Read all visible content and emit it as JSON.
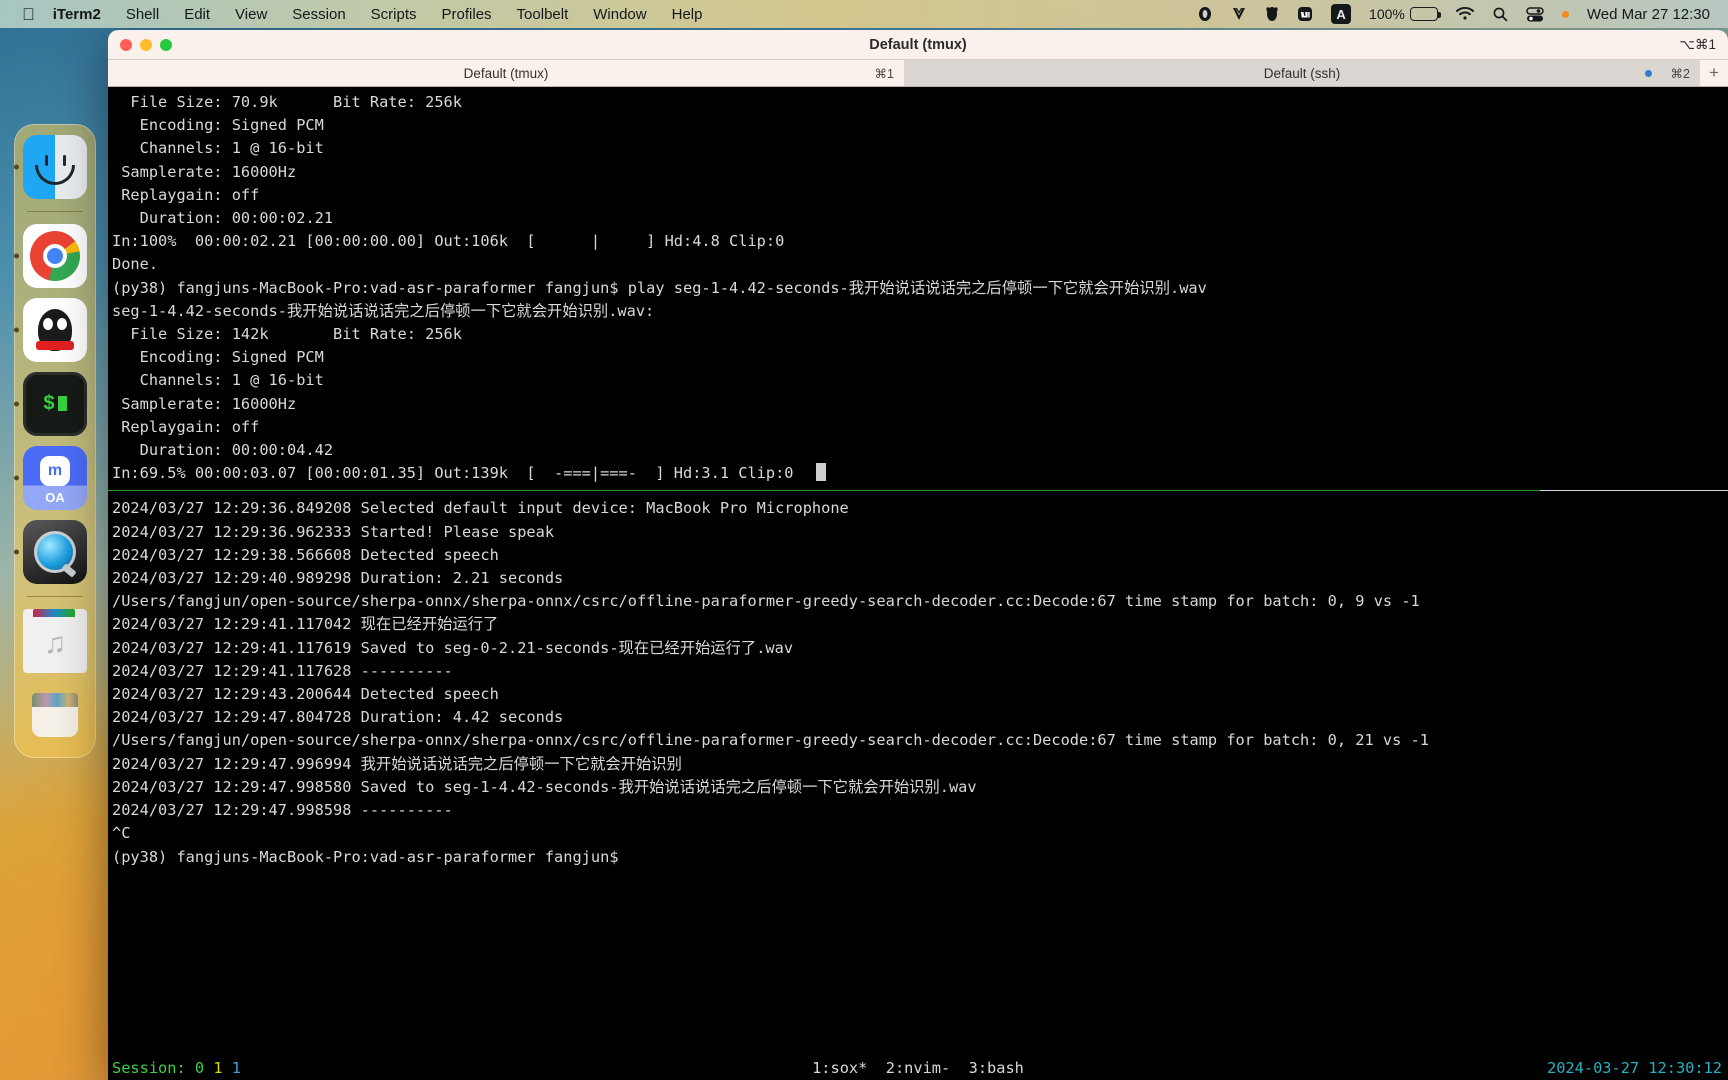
{
  "menubar": {
    "apple_icon": "apple-icon",
    "items": [
      {
        "label": "iTerm2",
        "bold": true
      },
      {
        "label": "Shell",
        "bold": false
      },
      {
        "label": "Edit",
        "bold": false
      },
      {
        "label": "View",
        "bold": false
      },
      {
        "label": "Session",
        "bold": false
      },
      {
        "label": "Scripts",
        "bold": false
      },
      {
        "label": "Profiles",
        "bold": false
      },
      {
        "label": "Toolbelt",
        "bold": false
      },
      {
        "label": "Window",
        "bold": false
      },
      {
        "label": "Help",
        "bold": false
      }
    ],
    "tray": {
      "battery_percent": "100%",
      "input_source": "A",
      "icons": [
        "opera-icon",
        "v-logo-icon",
        "qq-penguin-icon",
        "mi-icon",
        "input-source-icon",
        "battery-icon",
        "wifi-icon",
        "search-icon",
        "control-center-icon",
        "notification-dot-icon"
      ]
    },
    "clock": "Wed Mar 27  12:30"
  },
  "dock": {
    "items": [
      {
        "name": "finder",
        "label": "Finder",
        "running": true
      },
      {
        "name": "chrome",
        "label": "Google Chrome",
        "running": true
      },
      {
        "name": "qq",
        "label": "QQ",
        "running": true
      },
      {
        "name": "terminal",
        "label": "Terminal",
        "running": true
      },
      {
        "name": "mi-oa",
        "label": "OA",
        "running": true
      },
      {
        "name": "quicktime",
        "label": "QuickTime Player",
        "running": true
      },
      {
        "name": "music-folder",
        "label": "Music",
        "running": false
      },
      {
        "name": "trash",
        "label": "Trash",
        "running": false
      }
    ]
  },
  "window": {
    "title": "Default (tmux)",
    "badge": "⌥⌘1",
    "tabs": [
      {
        "label": "Default (tmux)",
        "shortcut": "⌘1",
        "active": false,
        "dot": false
      },
      {
        "label": "Default (ssh)",
        "shortcut": "⌘2",
        "active": true,
        "dot": true
      }
    ],
    "new_tab_label": "+"
  },
  "terminal": {
    "top_pane": [
      "  File Size: 70.9k      Bit Rate: 256k",
      "   Encoding: Signed PCM",
      "   Channels: 1 @ 16-bit",
      " Samplerate: 16000Hz",
      " Replaygain: off",
      "   Duration: 00:00:02.21",
      "",
      "In:100%  00:00:02.21 [00:00:00.00] Out:106k  [      |     ] Hd:4.8 Clip:0",
      "Done.",
      "(py38) fangjuns-MacBook-Pro:vad-asr-paraformer fangjun$ play seg-1-4.42-seconds-我开始说话说话完之后停顿一下它就会开始识别.wav",
      "",
      "seg-1-4.42-seconds-我开始说话说话完之后停顿一下它就会开始识别.wav:",
      "",
      "  File Size: 142k       Bit Rate: 256k",
      "   Encoding: Signed PCM",
      "   Channels: 1 @ 16-bit",
      " Samplerate: 16000Hz",
      " Replaygain: off",
      "   Duration: 00:00:04.42",
      "",
      "In:69.5% 00:00:03.07 [00:00:01.35] Out:139k  [  -===|===-  ] Hd:3.1 Clip:0"
    ],
    "bottom_pane": [
      "2024/03/27 12:29:36.849208 Selected default input device: MacBook Pro Microphone",
      "2024/03/27 12:29:36.962333 Started! Please speak",
      "2024/03/27 12:29:38.566608 Detected speech",
      "2024/03/27 12:29:40.989298 Duration: 2.21 seconds",
      "/Users/fangjun/open-source/sherpa-onnx/sherpa-onnx/csrc/offline-paraformer-greedy-search-decoder.cc:Decode:67 time stamp for batch: 0, 9 vs -1",
      "2024/03/27 12:29:41.117042 现在已经开始运行了",
      "2024/03/27 12:29:41.117619 Saved to seg-0-2.21-seconds-现在已经开始运行了.wav",
      "2024/03/27 12:29:41.117628 ----------",
      "2024/03/27 12:29:43.200644 Detected speech",
      "2024/03/27 12:29:47.804728 Duration: 4.42 seconds",
      "/Users/fangjun/open-source/sherpa-onnx/sherpa-onnx/csrc/offline-paraformer-greedy-search-decoder.cc:Decode:67 time stamp for batch: 0, 21 vs -1",
      "2024/03/27 12:29:47.996994 我开始说话说话完之后停顿一下它就会开始识别",
      "2024/03/27 12:29:47.998580 Saved to seg-1-4.42-seconds-我开始说话说话完之后停顿一下它就会开始识别.wav",
      "2024/03/27 12:29:47.998598 ----------",
      "^C",
      "(py38) fangjuns-MacBook-Pro:vad-asr-paraformer fangjun$"
    ]
  },
  "tmux_status": {
    "session_label": "Session: 0",
    "session_num1": "1",
    "session_num2": "1",
    "windows": "1:sox*  2:nvim-  3:bash",
    "datetime": "2024-03-27 12:30:12"
  },
  "colors": {
    "accent_green": "#3fd23f",
    "accent_yellow": "#d7d700",
    "accent_blue": "#3aa3e0",
    "accent_cyan": "#24b3c4",
    "terminal_bg": "#000000",
    "titlebar_bg": "#fbf1ec"
  }
}
